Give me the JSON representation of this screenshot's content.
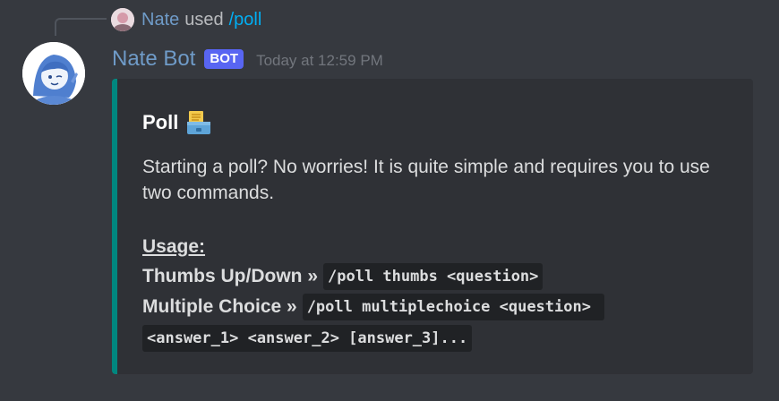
{
  "reply": {
    "user": "Nate",
    "used": "used",
    "command": "/poll"
  },
  "message": {
    "username": "Nate Bot",
    "badge": "BOT",
    "timestamp": "Today at 12:59 PM"
  },
  "embed": {
    "accent_color": "#00877f",
    "title": "Poll",
    "title_icon": "ballot-box-icon",
    "description": "Starting a poll? No worries! It is quite simple and requires you to use two commands.",
    "usage_label": "Usage:",
    "commands": [
      {
        "label": "Thumbs Up/Down »",
        "code": "/poll thumbs <question>"
      },
      {
        "label": "Multiple Choice »",
        "code": "/poll multiplechoice <question> ",
        "code_cont": "<answer_1> <answer_2> [answer_3]..."
      }
    ]
  }
}
